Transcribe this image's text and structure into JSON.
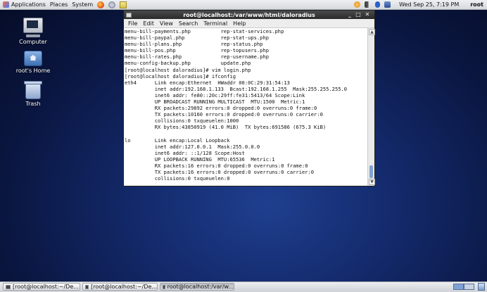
{
  "top_panel": {
    "applications": "Applications",
    "places": "Places",
    "system": "System",
    "clock": "Wed Sep 25,  7:19 PM",
    "user": "root"
  },
  "desktop_icons": [
    {
      "label": "Computer",
      "icon": "computer-icon"
    },
    {
      "label": "root's Home",
      "icon": "home-folder-icon"
    },
    {
      "label": "Trash",
      "icon": "trash-icon"
    }
  ],
  "terminal": {
    "title": "root@localhost:/var/www/html/daloradius",
    "menu": [
      "File",
      "Edit",
      "View",
      "Search",
      "Terminal",
      "Help"
    ],
    "lines": [
      "menu-bill-payments.php          rep-stat-services.php",
      "menu-bill-paypal.php            rep-stat-ups.php",
      "menu-bill-plans.php             rep-status.php",
      "menu-bill-pos.php               rep-topusers.php",
      "menu-bill-rates.php             rep-username.php",
      "menu-config-backup.php          update.php",
      "[root@localhost daloradius]# vim login.php",
      "[root@localhost daloradius]# ifconfig",
      "eth4      Link encap:Ethernet  HWaddr 00:0C:29:31:54:13",
      "          inet addr:192.168.1.133  Bcast:192.168.1.255  Mask:255.255.255.0",
      "          inet6 addr: fe80::20c:29ff:fe31:5413/64 Scope:Link",
      "          UP BROADCAST RUNNING MULTICAST  MTU:1500  Metric:1",
      "          RX packets:29892 errors:0 dropped:0 overruns:0 frame:0",
      "          TX packets:10160 errors:0 dropped:0 overruns:0 carrier:0",
      "          collisions:0 txqueuelen:1000",
      "          RX bytes:43850919 (41.0 MiB)  TX bytes:691586 (675.3 KiB)",
      "",
      "lo        Link encap:Local Loopback",
      "          inet addr:127.0.0.1  Mask:255.0.0.0",
      "          inet6 addr: ::1/128 Scope:Host",
      "          UP LOOPBACK RUNNING  MTU:65536  Metric:1",
      "          RX packets:16 errors:0 dropped:0 overruns:0 frame:0",
      "          TX packets:16 errors:0 dropped:0 overruns:0 carrier:0",
      "          collisions:0 txqueuelen:0"
    ]
  },
  "taskbar": {
    "tasks": [
      "[root@localhost:~/De...",
      "[root@localhost:~/De...",
      "root@localhost:/var/w..."
    ],
    "active_task": 2
  }
}
